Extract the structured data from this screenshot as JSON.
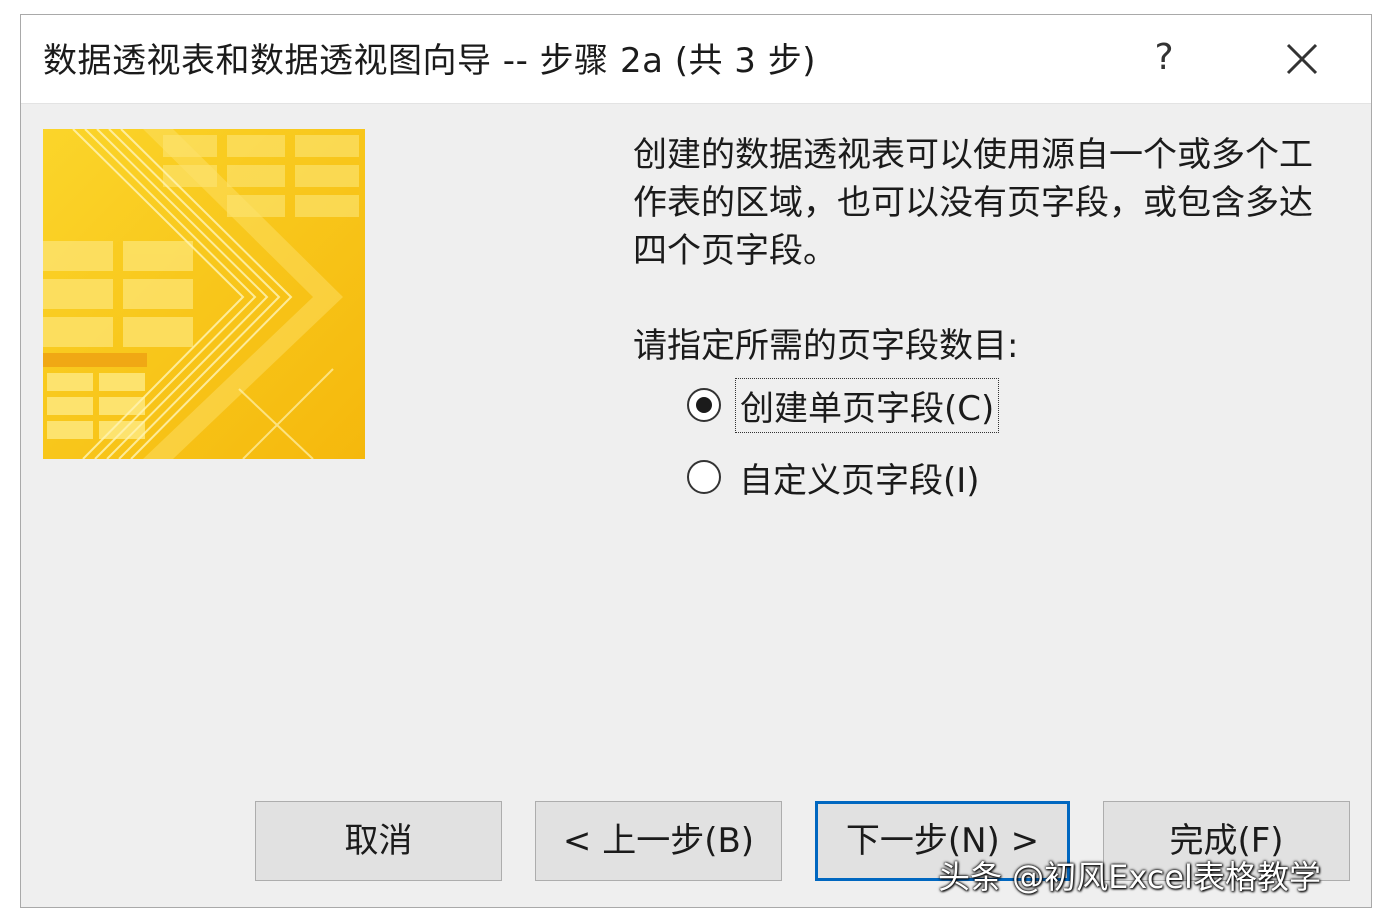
{
  "dialog": {
    "title": "数据透视表和数据透视图向导 -- 步骤 2a (共 3 步)",
    "help_label": "?",
    "description_lines": [
      "创建的数据透视表可以使用源自一个或多个工",
      "作表的区域，也可以没有页字段，或包含多达",
      "四个页字段。"
    ],
    "prompt": "请指定所需的页字段数目:",
    "options": [
      {
        "label": "创建单页字段(C)",
        "selected": true
      },
      {
        "label": "自定义页字段(I)",
        "selected": false
      }
    ],
    "buttons": {
      "cancel": "取消",
      "back": "< 上一步(B)",
      "next": "下一步(N) >",
      "finish": "完成(F)"
    }
  },
  "watermark": {
    "text": "头条 @初风Excel表格教学"
  },
  "colors": {
    "accent": "#0067c0",
    "image_yellow": "#f7c318",
    "image_orange": "#f0a814"
  }
}
